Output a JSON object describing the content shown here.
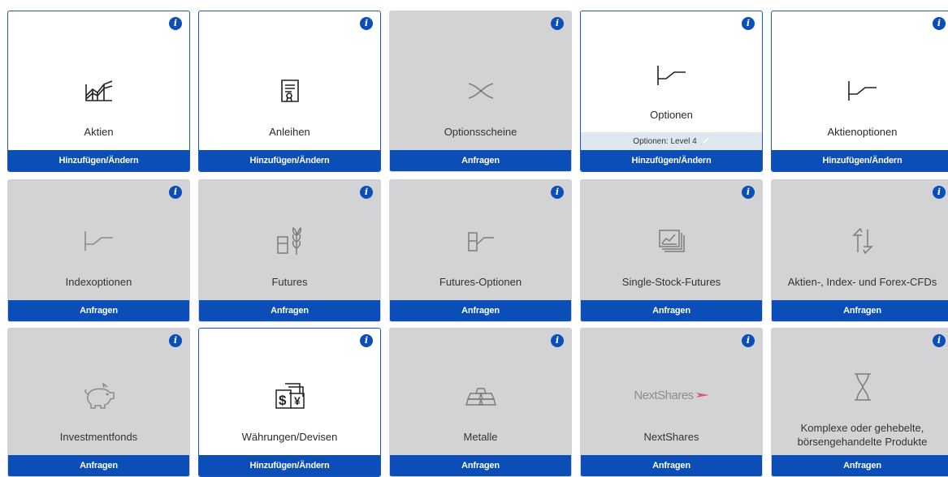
{
  "tiles": [
    {
      "label": "Aktien",
      "button": "Hinzufügen/Ändern",
      "active": true,
      "icon": "stock-chart-icon"
    },
    {
      "label": "Anleihen",
      "button": "Hinzufügen/Ändern",
      "active": true,
      "icon": "bond-certificate-icon"
    },
    {
      "label": "Optionsscheine",
      "button": "Anfragen",
      "active": false,
      "icon": "warrant-cross-icon"
    },
    {
      "label": "Optionen",
      "button": "Hinzufügen/Ändern",
      "active": true,
      "icon": "option-payoff-icon",
      "level": "Optionen: Level 4"
    },
    {
      "label": "Aktienoptionen",
      "button": "Hinzufügen/Ändern",
      "active": true,
      "icon": "option-payoff-icon"
    },
    {
      "label": "Indexoptionen",
      "button": "Anfragen",
      "active": false,
      "icon": "option-payoff-icon"
    },
    {
      "label": "Futures",
      "button": "Anfragen",
      "active": false,
      "icon": "wheat-futures-icon"
    },
    {
      "label": "Futures-Optionen",
      "button": "Anfragen",
      "active": false,
      "icon": "futures-option-icon"
    },
    {
      "label": "Single-Stock-Futures",
      "button": "Anfragen",
      "active": false,
      "icon": "stacked-charts-icon"
    },
    {
      "label": "Aktien-, Index- und Forex-CFDs",
      "button": "Anfragen",
      "active": false,
      "icon": "exchange-arrows-icon"
    },
    {
      "label": "Investmentfonds",
      "button": "Anfragen",
      "active": false,
      "icon": "piggy-bank-icon"
    },
    {
      "label": "Währungen/Devisen",
      "button": "Hinzufügen/Ändern",
      "active": true,
      "icon": "currency-bills-icon"
    },
    {
      "label": "Metalle",
      "button": "Anfragen",
      "active": false,
      "icon": "gold-bars-icon"
    },
    {
      "label": "NextShares",
      "button": "Anfragen",
      "active": false,
      "icon": "nextshares-logo",
      "logo_text": "NextShares"
    },
    {
      "label": "Komplexe oder gehebelte, börsengehandelte Produkte",
      "button": "Anfragen",
      "active": false,
      "icon": "hourglass-icon"
    }
  ],
  "info_glyph": "i",
  "colors": {
    "accent": "#0b4eb8",
    "inactive_bg": "#d3d3d6",
    "level_bg": "#dfe7ef"
  }
}
